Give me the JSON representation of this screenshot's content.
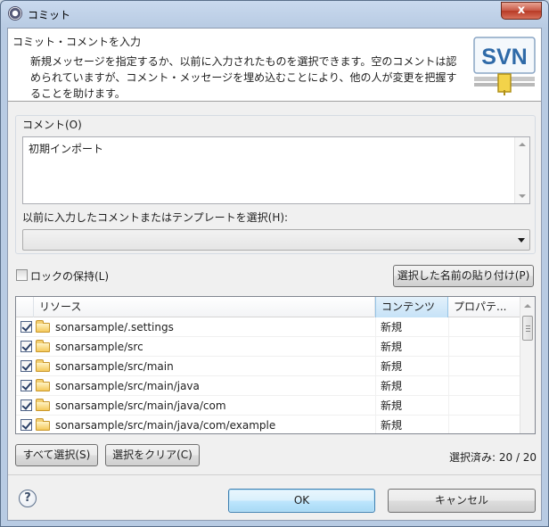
{
  "window": {
    "title": "コミット",
    "close_glyph": "x"
  },
  "header": {
    "title": "コミット・コメントを入力",
    "description": "新規メッセージを指定するか、以前に入力されたものを選択できます。空のコメントは認められていますが、コメント・メッセージを埋め込むことにより、他の人が変更を把握することを助けます。",
    "logo_text": "SVN"
  },
  "comment": {
    "group_label": "コメント(O)",
    "text": "初期インポート"
  },
  "history": {
    "label": "以前に入力したコメントまたはテンプレートを選択(H):",
    "selected": ""
  },
  "lock": {
    "label": "ロックの保持(L)",
    "checked": false
  },
  "paste_button": "選択した名前の貼り付け(P)",
  "table": {
    "columns": [
      "リソース",
      "コンテンツ",
      "プロパテ..."
    ],
    "rows": [
      {
        "resource": "sonarsample/.settings",
        "content": "新規",
        "props": "",
        "checked": true
      },
      {
        "resource": "sonarsample/src",
        "content": "新規",
        "props": "",
        "checked": true
      },
      {
        "resource": "sonarsample/src/main",
        "content": "新規",
        "props": "",
        "checked": true
      },
      {
        "resource": "sonarsample/src/main/java",
        "content": "新規",
        "props": "",
        "checked": true
      },
      {
        "resource": "sonarsample/src/main/java/com",
        "content": "新規",
        "props": "",
        "checked": true
      },
      {
        "resource": "sonarsample/src/main/java/com/example",
        "content": "新規",
        "props": "",
        "checked": true
      }
    ]
  },
  "select_all_button": "すべて選択(S)",
  "clear_button": "選択をクリア(C)",
  "selected_count": "選択済み: 20 / 20",
  "ok_button": "OK",
  "cancel_button": "キャンセル",
  "help_glyph": "?"
}
